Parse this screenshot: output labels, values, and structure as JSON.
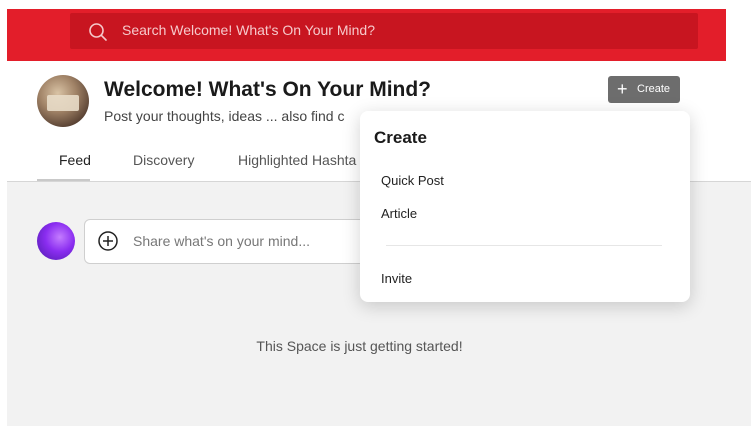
{
  "search": {
    "placeholder": "Search Welcome! What's On Your Mind?"
  },
  "space": {
    "title": "Welcome! What's On Your Mind?",
    "subtitle": "Post your thoughts, ideas ... also find c"
  },
  "tabs": [
    {
      "label": "Feed"
    },
    {
      "label": "Discovery"
    },
    {
      "label": "Highlighted Hashta"
    }
  ],
  "create_button": {
    "label": "Create",
    "icon": "plus-icon"
  },
  "composer": {
    "placeholder": "Share what's on your mind..."
  },
  "empty_state": "This Space is just getting started!",
  "create_menu": {
    "title": "Create",
    "items": [
      {
        "label": "Quick Post"
      },
      {
        "label": "Article"
      },
      {
        "label": "Invite"
      }
    ]
  },
  "colors": {
    "brand_red": "#e31e2a",
    "search_bg": "#c81520",
    "button_gray": "#6d6d6d"
  }
}
